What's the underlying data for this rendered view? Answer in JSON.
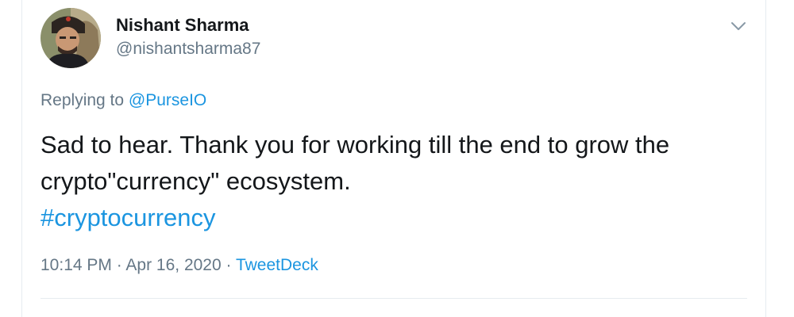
{
  "tweet": {
    "author": {
      "name": "Nishant Sharma",
      "handle": "@nishantsharma87"
    },
    "reply": {
      "prefix": "Replying to ",
      "mention": "@PurseIO"
    },
    "text_line1": "Sad to hear. Thank you for working till the end to grow the",
    "text_line2": "crypto\"currency\" ecosystem.",
    "hashtag": "#cryptocurrency",
    "time": "10:14 PM",
    "separator": " · ",
    "date": "Apr 16, 2020",
    "source": "TweetDeck"
  },
  "icons": {
    "menu": "chevron-down-icon",
    "avatar": "profile-photo"
  },
  "colors": {
    "link": "#1b95e0",
    "text": "#14171a",
    "secondary": "#657786",
    "border": "#e6ecf0"
  }
}
